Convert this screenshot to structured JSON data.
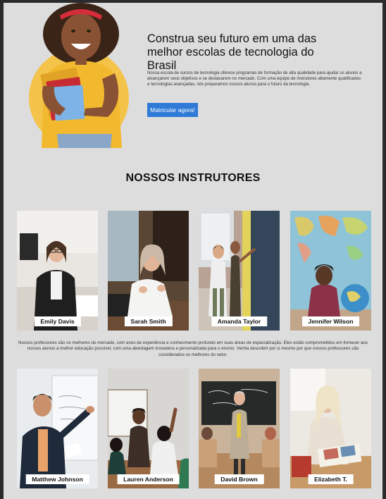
{
  "hero": {
    "title": "Construa seu futuro em uma das melhor escolas de tecnologia do Brasil",
    "description": "Nossa escola de cursos de tecnologia oferece programas de formação de alta qualidade para ajudar os alunos a alcançarem seus objetivos e se destacarem no mercado. Com uma equipe de instrutores altamente qualificados e tecnologias avançadas, nós preparamos nossos alunos para o futuro da tecnologia.",
    "cta_label": "Matricular agora!"
  },
  "instructors_section": {
    "title": "NOSSOS INSTRUTORES",
    "description": "Nossos professores são os melhores do mercado, com anos de experiência e conhecimento profundo em suas áreas de especialização. Eles estão comprometidos em fornecer aos nossos alunos a melhor educação possível, com uma abordagem inovadora e personalizada para o ensino. Venha descobrir por si mesmo por que nossos professores são considerados os melhores do setor."
  },
  "instructors": [
    {
      "name": "Emily Davis"
    },
    {
      "name": "Sarah Smith"
    },
    {
      "name": "Amanda Taylor"
    },
    {
      "name": "Jennifer Wilson"
    },
    {
      "name": "Matthew Johnson"
    },
    {
      "name": "Lauren Anderson"
    },
    {
      "name": "David Brown"
    },
    {
      "name": "Elizabeth T."
    }
  ],
  "colors": {
    "page_background": "#dddddd",
    "cta_background": "#2e7ad6",
    "hero_circle": "#f4c34a"
  }
}
